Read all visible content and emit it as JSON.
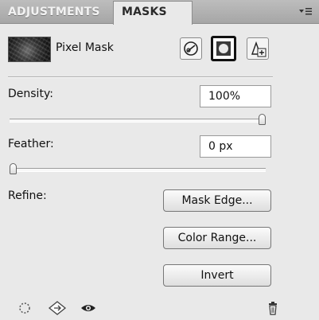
{
  "tabs": [
    {
      "label": "ADJUSTMENTS",
      "active": false
    },
    {
      "label": "MASKS",
      "active": true
    }
  ],
  "panel_menu_icon": "panel-menu-icon",
  "mask": {
    "label": "Pixel Mask",
    "buttons": [
      {
        "icon": "vector-mask-icon",
        "selected": false
      },
      {
        "icon": "pixel-mask-icon",
        "selected": true
      },
      {
        "icon": "add-vector-mask-icon",
        "selected": false
      }
    ]
  },
  "density": {
    "label": "Density:",
    "value": "100%",
    "slider_fraction": 1.0
  },
  "feather": {
    "label": "Feather:",
    "value": "0 px",
    "slider_fraction": 0.0
  },
  "refine": {
    "label": "Refine:",
    "mask_edge": "Mask Edge...",
    "color_range": "Color Range...",
    "invert": "Invert"
  },
  "bottom_icons": [
    "load-selection-icon",
    "apply-mask-icon",
    "eye-icon",
    "trash-icon"
  ],
  "colors": {
    "panel_bg": "#e9e9e9",
    "tabbar_bg": "#b2b2b2"
  }
}
